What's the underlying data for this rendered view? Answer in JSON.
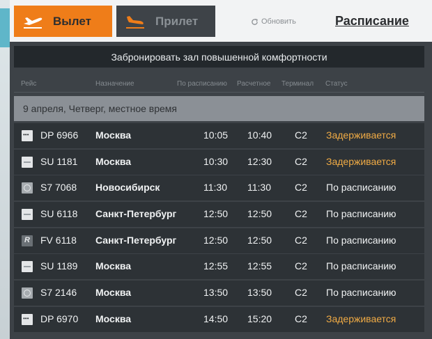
{
  "tabs": [
    {
      "label": "Вылет",
      "icon": "plane-takeoff-icon",
      "active": true
    },
    {
      "label": "Прилет",
      "icon": "plane-landing-icon",
      "active": false
    }
  ],
  "refresh": {
    "label": "Обновить",
    "icon": "refresh-icon"
  },
  "schedule_link": "Расписание",
  "vip_bar": "Забронировать зал повышенной комфортности",
  "columns": [
    "Рейс",
    "Назначение",
    "По расписанию",
    "Расчетное",
    "Терминал",
    "Статус"
  ],
  "date_header": "9 апреля, Четверг, местное время",
  "flights": [
    {
      "flight": "DP 6966",
      "airline_logo": "pobeda-logo",
      "destination": "Москва",
      "scheduled": "10:05",
      "estimated": "10:40",
      "terminal": "C2",
      "status": "Задерживается",
      "status_kind": "delayed"
    },
    {
      "flight": "SU 1181",
      "airline_logo": "aeroflot-logo",
      "destination": "Москва",
      "scheduled": "10:30",
      "estimated": "12:30",
      "terminal": "C2",
      "status": "Задерживается",
      "status_kind": "delayed"
    },
    {
      "flight": "S7 7068",
      "airline_logo": "s7-logo",
      "destination": "Новосибирск",
      "scheduled": "11:30",
      "estimated": "11:30",
      "terminal": "C2",
      "status": "По расписанию",
      "status_kind": "ontime"
    },
    {
      "flight": "SU 6118",
      "airline_logo": "aeroflot-logo",
      "destination": "Санкт-Петербург",
      "scheduled": "12:50",
      "estimated": "12:50",
      "terminal": "C2",
      "status": "По расписанию",
      "status_kind": "ontime"
    },
    {
      "flight": "FV 6118",
      "airline_logo": "rossiya-logo",
      "destination": "Санкт-Петербург",
      "scheduled": "12:50",
      "estimated": "12:50",
      "terminal": "C2",
      "status": "По расписанию",
      "status_kind": "ontime"
    },
    {
      "flight": "SU 1189",
      "airline_logo": "aeroflot-logo",
      "destination": "Москва",
      "scheduled": "12:55",
      "estimated": "12:55",
      "terminal": "C2",
      "status": "По расписанию",
      "status_kind": "ontime"
    },
    {
      "flight": "S7 2146",
      "airline_logo": "s7-logo",
      "destination": "Москва",
      "scheduled": "13:50",
      "estimated": "13:50",
      "terminal": "C2",
      "status": "По расписанию",
      "status_kind": "ontime"
    },
    {
      "flight": "DP 6970",
      "airline_logo": "pobeda-logo",
      "destination": "Москва",
      "scheduled": "14:50",
      "estimated": "15:20",
      "terminal": "C2",
      "status": "Задерживается",
      "status_kind": "delayed"
    }
  ],
  "colors": {
    "accent": "#ef7d19",
    "delayed": "#f0ab45",
    "board_bg": "#3d4247",
    "row_bg": "#2d3236"
  }
}
